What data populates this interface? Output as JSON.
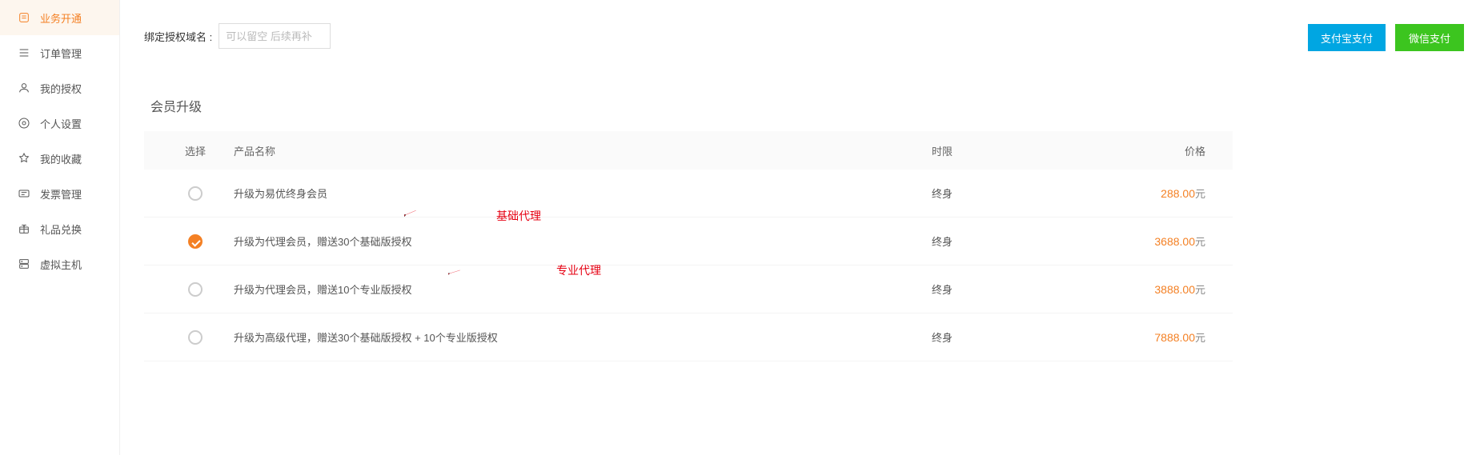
{
  "sidebar": {
    "items": [
      {
        "label": "业务开通",
        "active": true
      },
      {
        "label": "订单管理",
        "active": false
      },
      {
        "label": "我的授权",
        "active": false
      },
      {
        "label": "个人设置",
        "active": false
      },
      {
        "label": "我的收藏",
        "active": false
      },
      {
        "label": "发票管理",
        "active": false
      },
      {
        "label": "礼品兑换",
        "active": false
      },
      {
        "label": "虚拟主机",
        "active": false
      }
    ]
  },
  "topbar": {
    "domain_label": "绑定授权域名 :",
    "domain_placeholder": "可以留空 后续再补",
    "pay_alipay": "支付宝支付",
    "pay_wechat": "微信支付"
  },
  "section": {
    "title": "会员升级",
    "columns": {
      "select": "选择",
      "name": "产品名称",
      "duration": "时限",
      "price": "价格"
    },
    "rows": [
      {
        "name": "升级为易优终身会员",
        "duration": "终身",
        "price": "288.00",
        "unit": "元",
        "selected": false
      },
      {
        "name": "升级为代理会员，赠送30个基础版授权",
        "duration": "终身",
        "price": "3688.00",
        "unit": "元",
        "selected": true
      },
      {
        "name": "升级为代理会员，赠送10个专业版授权",
        "duration": "终身",
        "price": "3888.00",
        "unit": "元",
        "selected": false
      },
      {
        "name": "升级为高级代理，赠送30个基础版授权 + 10个专业版授权",
        "duration": "终身",
        "price": "7888.00",
        "unit": "元",
        "selected": false
      }
    ]
  },
  "annotations": {
    "basic_label": "基础代理",
    "pro_label": "专业代理"
  }
}
